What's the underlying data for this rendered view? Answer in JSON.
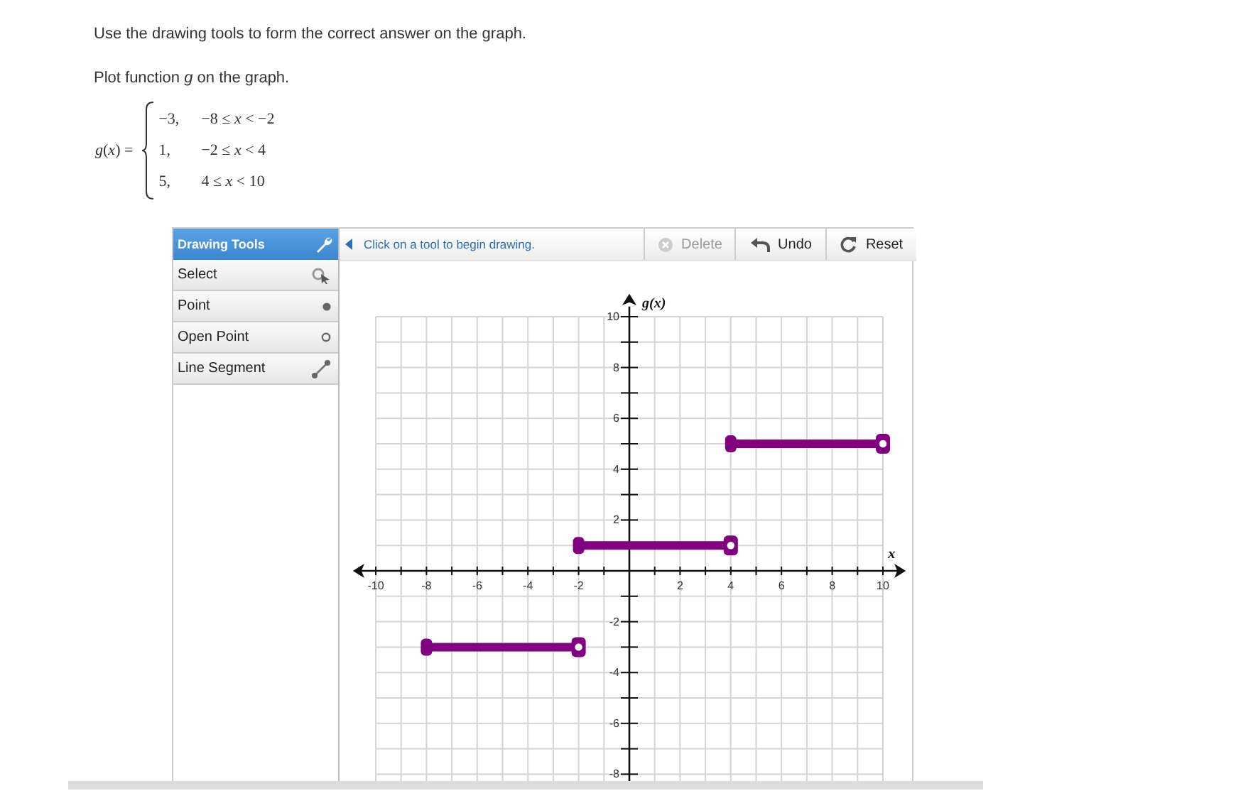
{
  "instructions": "Use the drawing tools to form the correct answer on the graph.",
  "prompt": "Plot function *g* on the graph.",
  "function": {
    "name": "*g*(*x*) =",
    "cases": [
      {
        "value": "−3,",
        "condition": "−8 ≤ *x* < −2"
      },
      {
        "value": "1,",
        "condition": "−2 ≤ *x* < 4"
      },
      {
        "value": "5,",
        "condition": "4 ≤ *x* < 10"
      }
    ]
  },
  "widget": {
    "sidebar": {
      "title": "Drawing Tools",
      "tools": [
        {
          "label": "Select",
          "kind": "select",
          "selected": false
        },
        {
          "label": "Point",
          "kind": "point",
          "selected": false
        },
        {
          "label": "Open Point",
          "kind": "open_point",
          "selected": false
        },
        {
          "label": "Line Segment",
          "kind": "segment",
          "selected": false
        }
      ]
    },
    "hint": "Click on a tool to begin drawing.",
    "buttons": [
      {
        "label": "Delete",
        "kind": "delete",
        "disabled": true
      },
      {
        "label": "Undo",
        "kind": "undo",
        "disabled": false
      },
      {
        "label": "Reset",
        "kind": "reset",
        "disabled": false
      }
    ],
    "graph": {
      "chart_data": {
        "type": "line",
        "xlabel": "x",
        "ylabel": "g(x)",
        "grid": true,
        "x": [
          -8,
          -2,
          4,
          10
        ],
        "series": [
          {
            "color": "#800080",
            "marker": "square",
            "values": [
              -3,
              -3,
              null,
              null
            ]
          },
          {
            "color": "#800080",
            "marker": "square",
            "values": [
              null,
              1,
              1,
              null
            ]
          },
          {
            "color": "#800080",
            "marker": "square",
            "values": [
              null,
              null,
              5,
              5
            ]
          }
        ],
        "xlim": [
          -10,
          10
        ],
        "ylim": [
          -8,
          10
        ],
        "xticks": [
          -10,
          -8,
          -6,
          -4,
          -2,
          2,
          4,
          6,
          8,
          10
        ],
        "yticks": [
          -8,
          -6,
          -4,
          -2,
          2,
          4,
          6,
          8,
          10
        ]
      }
    }
  }
}
